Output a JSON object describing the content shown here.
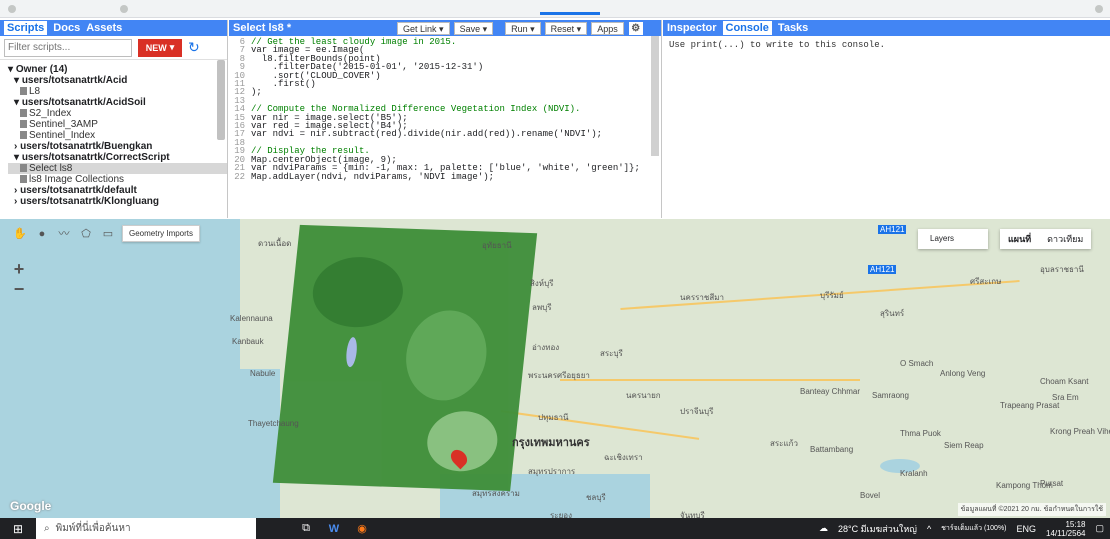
{
  "left_panel": {
    "tabs": [
      "Scripts",
      "Docs",
      "Assets"
    ],
    "filter_placeholder": "Filter scripts...",
    "new_button": "NEW",
    "tree": [
      {
        "label": "Owner (14)",
        "level": 0,
        "bold": true
      },
      {
        "label": "users/totsanatrtk/Acid",
        "level": 1,
        "bold": true
      },
      {
        "label": "L8",
        "level": 2
      },
      {
        "label": "users/totsanatrtk/AcidSoil",
        "level": 1,
        "bold": true
      },
      {
        "label": "S2_Index",
        "level": 2
      },
      {
        "label": "Sentinel_3AMP",
        "level": 2
      },
      {
        "label": "Sentinel_Index",
        "level": 2
      },
      {
        "label": "users/totsanatrtk/Buengkan",
        "level": 1,
        "bold": true
      },
      {
        "label": "users/totsanatrtk/CorrectScript",
        "level": 1,
        "bold": true
      },
      {
        "label": "Select ls8",
        "level": 2,
        "selected": true
      },
      {
        "label": "ls8 Image Collections",
        "level": 2
      },
      {
        "label": "users/totsanatrtk/default",
        "level": 1,
        "bold": true
      },
      {
        "label": "users/totsanatrtk/Klongluang",
        "level": 1,
        "bold": true
      }
    ]
  },
  "code_panel": {
    "title": "Select ls8 *",
    "buttons": {
      "get_link": "Get Link",
      "save": "Save",
      "run": "Run",
      "reset": "Reset",
      "apps": "Apps"
    },
    "lines": [
      {
        "n": "6",
        "t": "// Get the least cloudy image in 2015."
      },
      {
        "n": "7",
        "t": "var image = ee.Image("
      },
      {
        "n": "8",
        "t": "  l8.filterBounds(point)"
      },
      {
        "n": "9",
        "t": "    .filterDate('2015-01-01', '2015-12-31')"
      },
      {
        "n": "10",
        "t": "    .sort('CLOUD_COVER')"
      },
      {
        "n": "11",
        "t": "    .first()"
      },
      {
        "n": "12",
        "t": ");"
      },
      {
        "n": "13",
        "t": ""
      },
      {
        "n": "14",
        "t": "// Compute the Normalized Difference Vegetation Index (NDVI)."
      },
      {
        "n": "15",
        "t": "var nir = image.select('B5');"
      },
      {
        "n": "16",
        "t": "var red = image.select('B4');"
      },
      {
        "n": "17",
        "t": "var ndvi = nir.subtract(red).divide(nir.add(red)).rename('NDVI');"
      },
      {
        "n": "18",
        "t": ""
      },
      {
        "n": "19",
        "t": "// Display the result."
      },
      {
        "n": "20",
        "t": "Map.centerObject(image, 9);"
      },
      {
        "n": "21",
        "t": "var ndviParams = {min: -1, max: 1, palette: ['blue', 'white', 'green']};"
      },
      {
        "n": "22",
        "t": "Map.addLayer(ndvi, ndviParams, 'NDVI image');"
      }
    ]
  },
  "right_panel": {
    "tabs": [
      "Inspector",
      "Console",
      "Tasks"
    ],
    "console_text": "Use print(...) to write to this console."
  },
  "map": {
    "geometry_imports": "Geometry Imports",
    "layers": "Layers",
    "map_types": [
      "แผนที่",
      "ดาวเทียม"
    ],
    "google": "Google",
    "attribution": "ข้อมูลแผนที่ ©2021  20 กม.  ข้อกำหนดในการใช้",
    "places": {
      "bangkok": "กรุงเทพมหานคร",
      "samut_prakan": "สมุทรปราการ",
      "chachoengsao": "ฉะเชิงเทรา",
      "nakhon_nayok": "นครนายก",
      "prachinburi": "ปราจีนบุรี",
      "sa_kaeo": "สระแก้ว",
      "saraburi": "สระบุรี",
      "lopburi": "ลพบุรี",
      "nakhon_ratchasima": "นครราชสีมา",
      "buriram": "บุรีรัมย์",
      "surin": "สุรินทร์",
      "sisaket": "ศรีสะเกษ",
      "ubon": "อุบลราชธานี",
      "uthai_thani": "อุทัยธานี",
      "samut_songkhram": "สมุทรสงคราม",
      "chonburi": "ชลบุรี",
      "rayong": "ระยอง",
      "chanthaburi": "จันทบุรี",
      "pathum_thani": "ปทุมธานี",
      "ang_thong": "อ่างทอง",
      "sing_buri": "สิงห์บุรี",
      "phra_nakhon": "พระนครศรีอยุธยา",
      "kalennauna": "Kalennauna",
      "kanbauk": "Kanbauk",
      "nabule": "Nabule",
      "thayetchaung": "Thayetchaung",
      "banteay": "Banteay Chhmar",
      "samraong": "Samraong",
      "siem_reap": "Siem Reap",
      "thma_puok": "Thma Puok",
      "battambang": "Battambang",
      "pursat": "Pursat",
      "trapeang": "Trapeang Prasat",
      "choam_ksant": "Choam Ksant",
      "kampong": "Kampong Thom",
      "bovel": "Bovel",
      "sra_em": "Sra Em",
      "o_smach": "O Smach",
      "anlong_veng": "Anlong Veng",
      "krong": "Krong Preah Vihear",
      "kralanh": "Kralanh",
      "road_ah121": "AH121",
      "road_ah121b": "AH121"
    }
  },
  "taskbar": {
    "search_placeholder": "พิมพ์ที่นี่เพื่อค้นหา",
    "weather": "28°C มีเมฆส่วนใหญ่",
    "lang": "ENG",
    "time": "15:18",
    "date": "14/11/2564",
    "battery": "ชาร์จเต็มแล้ว (100%)"
  }
}
